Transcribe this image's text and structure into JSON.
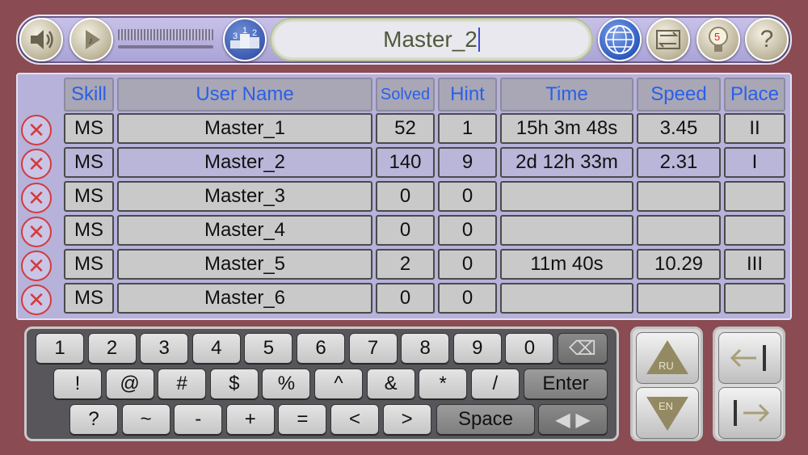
{
  "toolbar": {
    "title_value": "Master_2",
    "icons": [
      "speaker-icon",
      "play-icon",
      "podium-icon",
      "globe-icon",
      "swap-icon",
      "hint-bulb-icon",
      "help-icon"
    ],
    "podium_digits": [
      "3",
      "1",
      "2"
    ],
    "hint_badge": "5",
    "help_label": "?"
  },
  "table": {
    "headers": [
      "Skill",
      "User Name",
      "Solved",
      "Hint",
      "Time",
      "Speed",
      "Place"
    ],
    "rows": [
      {
        "skill": "MS",
        "name": "Master_1",
        "solved": "52",
        "hint": "1",
        "time": "15h 3m 48s",
        "speed": "3.45",
        "place": "II"
      },
      {
        "skill": "MS",
        "name": "Master_2",
        "solved": "140",
        "hint": "9",
        "time": "2d 12h 33m",
        "speed": "2.31",
        "place": "I"
      },
      {
        "skill": "MS",
        "name": "Master_3",
        "solved": "0",
        "hint": "0",
        "time": "",
        "speed": "",
        "place": ""
      },
      {
        "skill": "MS",
        "name": "Master_4",
        "solved": "0",
        "hint": "0",
        "time": "",
        "speed": "",
        "place": ""
      },
      {
        "skill": "MS",
        "name": "Master_5",
        "solved": "2",
        "hint": "0",
        "time": "11m 40s",
        "speed": "10.29",
        "place": "III"
      },
      {
        "skill": "MS",
        "name": "Master_6",
        "solved": "0",
        "hint": "0",
        "time": "",
        "speed": "",
        "place": ""
      }
    ],
    "delete_symbol": "✕"
  },
  "keyboard": {
    "row1": [
      "1",
      "2",
      "3",
      "4",
      "5",
      "6",
      "7",
      "8",
      "9",
      "0"
    ],
    "backspace": "⌫",
    "row2": [
      "!",
      "@",
      "#",
      "$",
      "%",
      "^",
      "&",
      "*",
      "/"
    ],
    "enter": "Enter",
    "row3": [
      "?",
      "~",
      "-",
      "+",
      "=",
      "<",
      ">"
    ],
    "space": "Space",
    "cursor_keys": "◀ ▶"
  },
  "lang": {
    "up": "RU",
    "down": "EN"
  },
  "arrows": {
    "left": "←|",
    "right": "|→"
  }
}
